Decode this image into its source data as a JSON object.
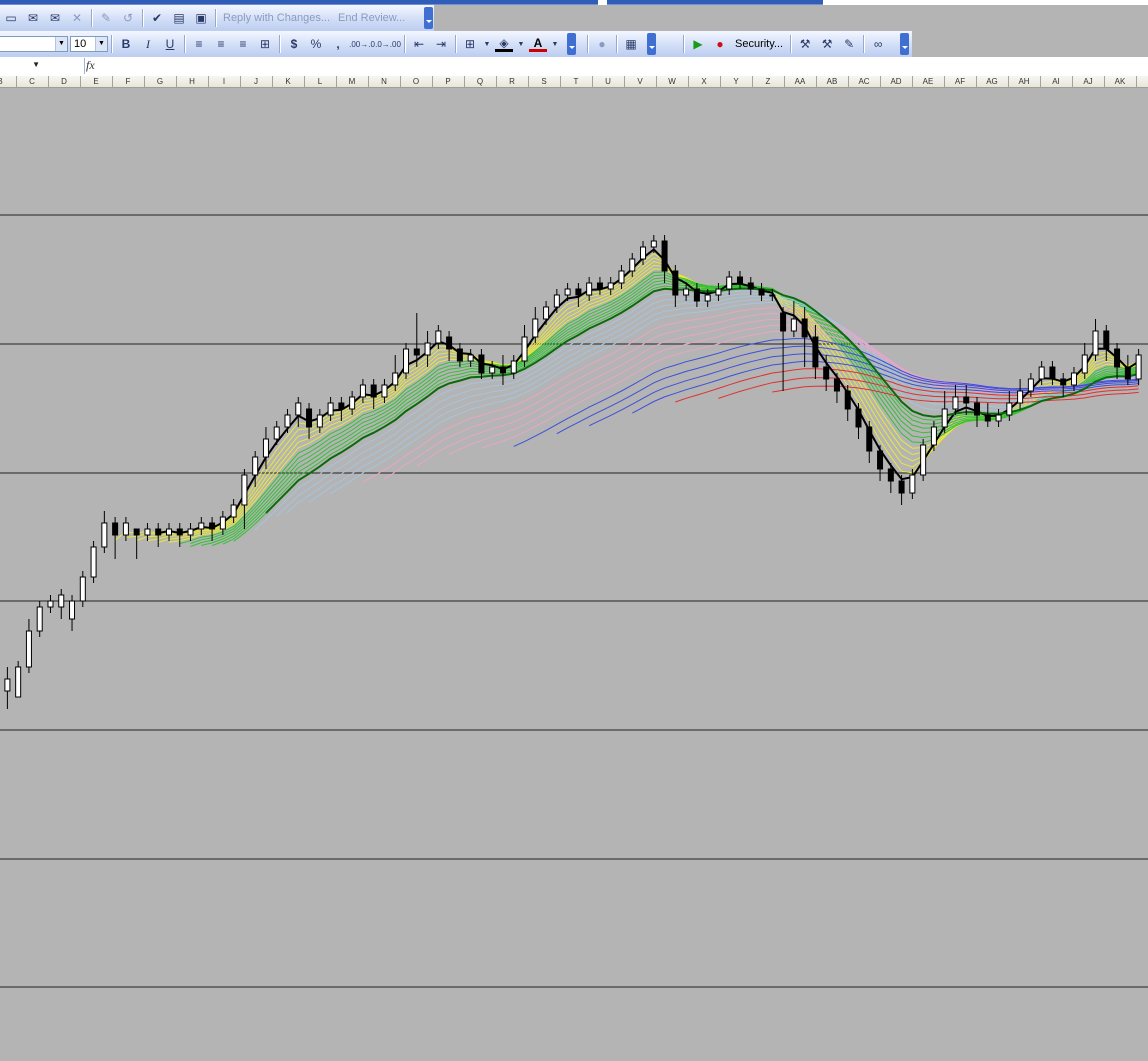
{
  "toolbar1": {
    "reply_with_changes": "Reply with Changes...",
    "end_review": "End Review..."
  },
  "toolbar2": {
    "font_size": "10",
    "bold": "B",
    "italic": "I",
    "underline": "U",
    "currency": "$",
    "percent": "%",
    "comma": ",",
    "increase_decimal": ".00→.0",
    "decrease_decimal": ".0→.00",
    "font_color_label": "A",
    "security": "Security..."
  },
  "formula_bar": {
    "fx": "fx"
  },
  "columns": [
    "B",
    "C",
    "D",
    "E",
    "F",
    "G",
    "H",
    "I",
    "J",
    "K",
    "L",
    "M",
    "N",
    "O",
    "P",
    "Q",
    "R",
    "S",
    "T",
    "U",
    "V",
    "W",
    "X",
    "Y",
    "Z",
    "AA",
    "AB",
    "AC",
    "AD",
    "AE",
    "AF",
    "AG",
    "AH",
    "AI",
    "AJ",
    "AK"
  ],
  "colors": {
    "background": "#b4b4b4",
    "yellow": "#e8e83a",
    "green": "#35c035",
    "dark_green": "#0b6a0b",
    "light_blue": "#a6c4dd",
    "pink": "#e6a6c6",
    "blue": "#3c4fd8",
    "red": "#e03030",
    "magenta": "#d63cd6"
  },
  "chart_data": {
    "type": "candlestick",
    "title": "",
    "xlabel": "",
    "ylabel": "",
    "grid": "horizontal",
    "ylim": [
      0,
      100
    ],
    "overlay": "guppy moving average ribbons (yellow, green, light blue, pink, blue, red bands)",
    "candles": [
      [
        1,
        16,
        18,
        13,
        20
      ],
      [
        3,
        15,
        20,
        18,
        21
      ],
      [
        5,
        20,
        26,
        19,
        28
      ],
      [
        7,
        26,
        30,
        25,
        31
      ],
      [
        9,
        30,
        31,
        29,
        32
      ],
      [
        11,
        30,
        32,
        28,
        33
      ],
      [
        13,
        28,
        31,
        26,
        32
      ],
      [
        15,
        31,
        35,
        30,
        36
      ],
      [
        17,
        35,
        40,
        34,
        41
      ],
      [
        19,
        40,
        44,
        39,
        46
      ],
      [
        21,
        44,
        42,
        38,
        45
      ],
      [
        23,
        42,
        44,
        41,
        45
      ],
      [
        25,
        43,
        42,
        38,
        43
      ],
      [
        27,
        42,
        43,
        41,
        44
      ],
      [
        29,
        43,
        42,
        40,
        44
      ],
      [
        31,
        42,
        43,
        41,
        44
      ],
      [
        33,
        43,
        42,
        40,
        44
      ],
      [
        35,
        42,
        43,
        41,
        44
      ],
      [
        37,
        43,
        44,
        42,
        45
      ],
      [
        39,
        44,
        43,
        41,
        45
      ],
      [
        41,
        43,
        45,
        42,
        46
      ],
      [
        43,
        45,
        47,
        44,
        48
      ],
      [
        45,
        47,
        52,
        43,
        53
      ],
      [
        47,
        52,
        55,
        50,
        56
      ],
      [
        49,
        55,
        58,
        53,
        60
      ],
      [
        51,
        58,
        60,
        57,
        61
      ],
      [
        53,
        60,
        62,
        59,
        63
      ],
      [
        55,
        62,
        64,
        60,
        65
      ],
      [
        57,
        63,
        60,
        58,
        64
      ],
      [
        59,
        60,
        62,
        59,
        63
      ],
      [
        61,
        62,
        64,
        61,
        65
      ],
      [
        63,
        64,
        63,
        61,
        65
      ],
      [
        65,
        63,
        65,
        62,
        66
      ],
      [
        67,
        65,
        67,
        64,
        68
      ],
      [
        69,
        67,
        65,
        63,
        68
      ],
      [
        71,
        65,
        67,
        64,
        68
      ],
      [
        73,
        67,
        69,
        66,
        72
      ],
      [
        75,
        69,
        73,
        68,
        74
      ],
      [
        77,
        73,
        72,
        70,
        79
      ],
      [
        79,
        72,
        74,
        70,
        76
      ],
      [
        81,
        74,
        76,
        73,
        77
      ],
      [
        83,
        75,
        73,
        71,
        76
      ],
      [
        85,
        73,
        71,
        70,
        74
      ],
      [
        87,
        71,
        72,
        70,
        73
      ],
      [
        89,
        72,
        69,
        68,
        73
      ],
      [
        91,
        69,
        70,
        68,
        71
      ],
      [
        93,
        70,
        69,
        67,
        72
      ],
      [
        95,
        69,
        71,
        68,
        72
      ],
      [
        97,
        71,
        75,
        70,
        77
      ],
      [
        99,
        75,
        78,
        74,
        80
      ],
      [
        101,
        78,
        80,
        77,
        81
      ],
      [
        103,
        80,
        82,
        79,
        83
      ],
      [
        105,
        82,
        83,
        81,
        84
      ],
      [
        107,
        83,
        82,
        80,
        84
      ],
      [
        109,
        82,
        84,
        81,
        85
      ],
      [
        111,
        84,
        83,
        82,
        85
      ],
      [
        113,
        83,
        84,
        82,
        85
      ],
      [
        115,
        84,
        86,
        83,
        87
      ],
      [
        117,
        86,
        88,
        85,
        89
      ],
      [
        119,
        88,
        90,
        87,
        91
      ],
      [
        121,
        90,
        91,
        89,
        92
      ],
      [
        123,
        91,
        86,
        84,
        92
      ],
      [
        125,
        86,
        82,
        80,
        87
      ],
      [
        127,
        82,
        83,
        81,
        84
      ],
      [
        129,
        83,
        81,
        80,
        84
      ],
      [
        131,
        81,
        82,
        80,
        83
      ],
      [
        133,
        82,
        83,
        81,
        84
      ],
      [
        135,
        83,
        85,
        82,
        86
      ],
      [
        137,
        85,
        84,
        83,
        86
      ],
      [
        139,
        84,
        83,
        82,
        85
      ],
      [
        141,
        83,
        82,
        81,
        84
      ],
      [
        143,
        82,
        82,
        81,
        83
      ],
      [
        145,
        79,
        76,
        66,
        80
      ],
      [
        147,
        76,
        78,
        75,
        81
      ],
      [
        149,
        78,
        75,
        70,
        80
      ],
      [
        151,
        75,
        70,
        68,
        77
      ],
      [
        153,
        70,
        68,
        66,
        72
      ],
      [
        155,
        68,
        66,
        64,
        69
      ],
      [
        157,
        66,
        63,
        61,
        67
      ],
      [
        159,
        63,
        60,
        58,
        64
      ],
      [
        161,
        60,
        56,
        54,
        61
      ],
      [
        163,
        56,
        53,
        51,
        57
      ],
      [
        165,
        53,
        51,
        49,
        54
      ],
      [
        167,
        51,
        49,
        47,
        52
      ],
      [
        169,
        49,
        52,
        48,
        53
      ],
      [
        171,
        52,
        57,
        51,
        58
      ],
      [
        173,
        57,
        60,
        56,
        61
      ],
      [
        175,
        60,
        63,
        59,
        66
      ],
      [
        177,
        63,
        65,
        62,
        67
      ],
      [
        179,
        65,
        64,
        62,
        67
      ],
      [
        181,
        64,
        62,
        60,
        65
      ],
      [
        183,
        62,
        61,
        60,
        64
      ],
      [
        185,
        61,
        62,
        60,
        63
      ],
      [
        187,
        62,
        64,
        61,
        66
      ],
      [
        189,
        64,
        66,
        63,
        68
      ],
      [
        191,
        66,
        68,
        65,
        69
      ],
      [
        193,
        68,
        70,
        67,
        71
      ],
      [
        195,
        70,
        68,
        67,
        71
      ],
      [
        197,
        68,
        67,
        65,
        69
      ],
      [
        199,
        67,
        69,
        66,
        70
      ],
      [
        201,
        69,
        72,
        68,
        74
      ],
      [
        203,
        72,
        76,
        71,
        78
      ],
      [
        205,
        76,
        73,
        71,
        77
      ],
      [
        207,
        73,
        70,
        68,
        74
      ],
      [
        209,
        70,
        68,
        67,
        72
      ],
      [
        211,
        68,
        72,
        67,
        73
      ]
    ]
  }
}
